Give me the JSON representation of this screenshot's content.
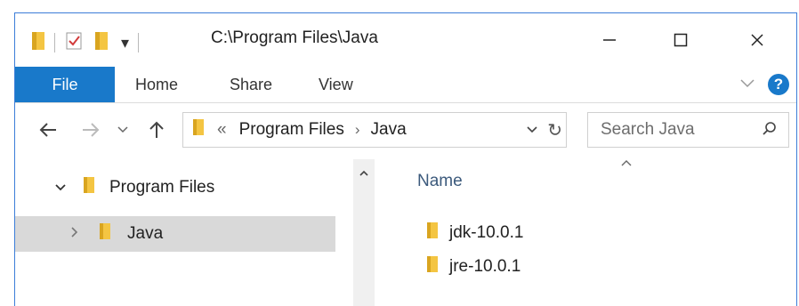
{
  "window": {
    "title": "C:\\Program Files\\Java",
    "minimize_glyph": "—",
    "maximize_glyph": "☐",
    "close_glyph": "✕"
  },
  "quick_access": {
    "dropdown_glyph": "▾"
  },
  "ribbon": {
    "tabs": [
      "File",
      "Home",
      "Share",
      "View"
    ],
    "collapse_glyph": "⌄",
    "help_glyph": "?"
  },
  "navigation": {
    "back_glyph": "←",
    "forward_glyph": "→",
    "recent_glyph": "⌄",
    "up_glyph": "↑",
    "address": {
      "overflow_glyph": "«",
      "crumbs": [
        "Program Files",
        "Java"
      ],
      "crumb_separator": "›",
      "dropdown_glyph": "⌄",
      "refresh_glyph": "↻"
    },
    "search": {
      "placeholder": "Search Java"
    }
  },
  "tree": {
    "items": [
      {
        "label": "Program Files",
        "expander": "⌄"
      },
      {
        "label": "Java",
        "expander": "›"
      }
    ],
    "scroll_up_glyph": "^"
  },
  "content": {
    "sort_glyph": "^",
    "columns": [
      "Name"
    ],
    "files": [
      {
        "name": "jdk-10.0.1"
      },
      {
        "name": "jre-10.0.1"
      }
    ]
  },
  "colors": {
    "accent": "#1979ca",
    "folder_yellow": "#f4c542",
    "folder_shade": "#d9a520",
    "selection": "#d9d9d9"
  }
}
